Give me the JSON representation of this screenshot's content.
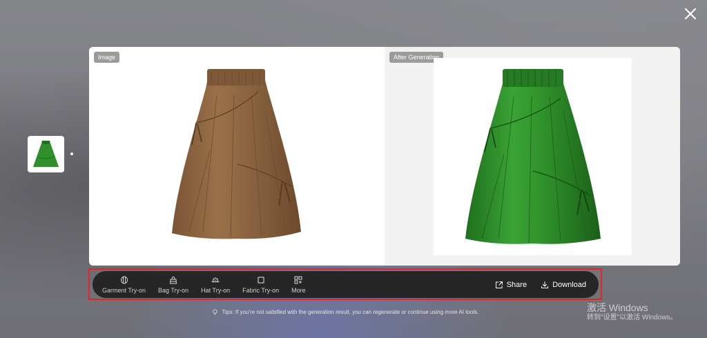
{
  "panels": {
    "left_label": "Image",
    "right_label": "After Generation"
  },
  "toolbar": {
    "tools": [
      {
        "label": "Garment Try-on",
        "icon": "garment-icon"
      },
      {
        "label": "Bag Try-on",
        "icon": "bag-icon"
      },
      {
        "label": "Hat Try-on",
        "icon": "hat-icon"
      },
      {
        "label": "Fabric Try-on",
        "icon": "fabric-icon"
      },
      {
        "label": "More",
        "icon": "grid-plus-icon"
      }
    ],
    "share_label": "Share",
    "download_label": "Download"
  },
  "tips": "Tips: If you're not satisfied with the generation result, you can regenerate or continue using more AI tools.",
  "watermark": {
    "line1": "激活 Windows",
    "line2": "转到\"设置\"以激活 Windows。"
  },
  "colors": {
    "toolbar_bg": "#262626",
    "highlight": "#e0262b",
    "original_skirt": "#8a6440",
    "generated_skirt": "#2f8f2a"
  }
}
